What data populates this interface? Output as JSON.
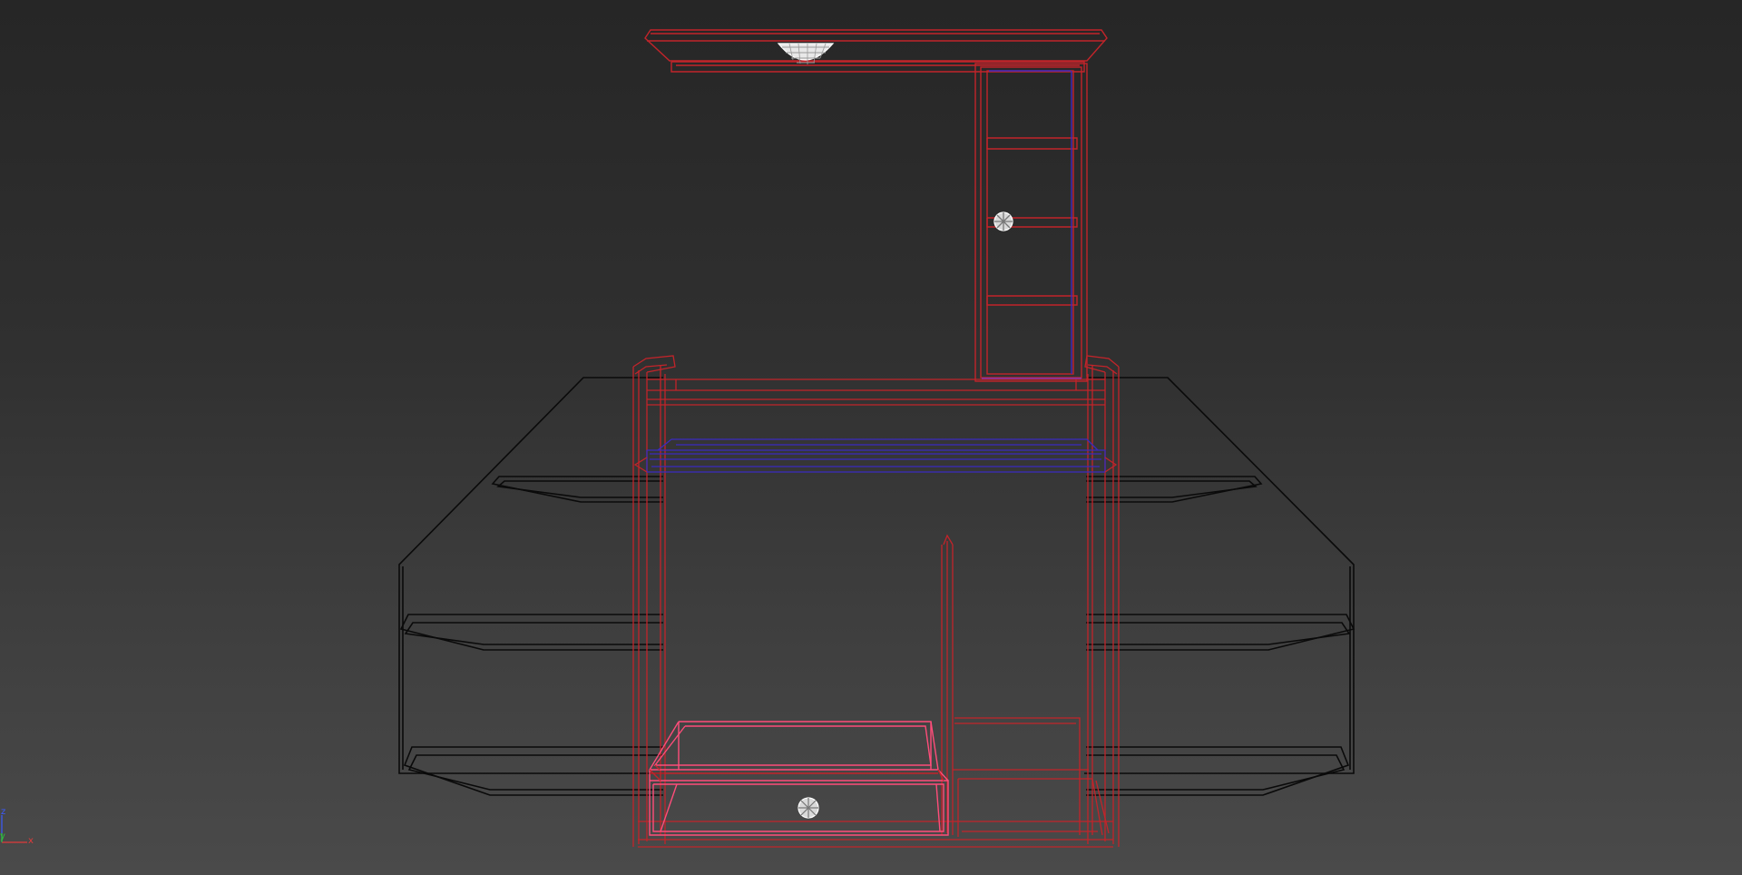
{
  "viewport": {
    "view": "Front",
    "shading": "Wireframe",
    "background": [
      "#262626",
      "#4a4a4a"
    ]
  },
  "colors": {
    "unselected_wire": "#0a0a0a",
    "selected_wire": "#c2242a",
    "highlight_wire": "#ff4d7a",
    "glass_wire": "#3a2bbf",
    "light_gizmo": "#ffffff"
  },
  "axis_tripod": {
    "z_label": "z",
    "y_label": "y",
    "x_label": "x",
    "z_color": "#3b5bff",
    "y_color": "#2fbf3a",
    "x_color": "#e03a3a"
  }
}
